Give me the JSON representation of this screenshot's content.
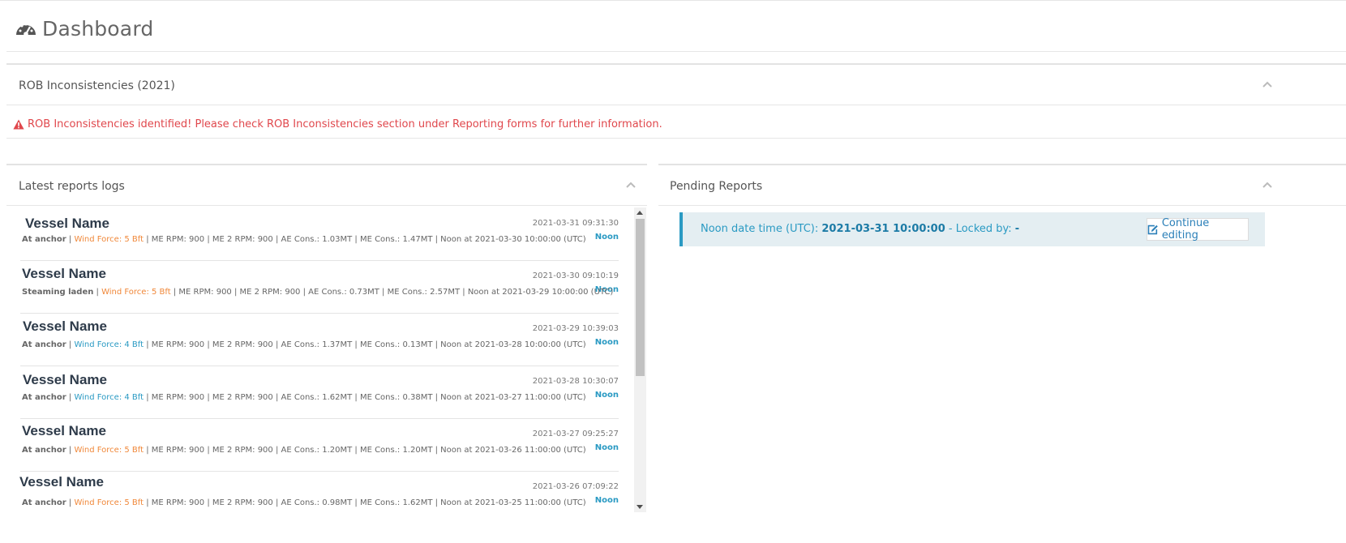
{
  "header": {
    "title": "Dashboard",
    "icon": "tachometer-icon"
  },
  "rob_panel": {
    "title": "ROB Inconsistencies (2021)",
    "alert": "ROB Inconsistencies identified! Please check ROB Inconsistencies section under Reporting forms for further information.",
    "alert_color": "#e0474c"
  },
  "latest_logs": {
    "title": "Latest reports logs",
    "items": [
      {
        "vessel": "Vessel Name",
        "timestamp": "2021-03-31 09:31:30",
        "type": "Noon",
        "status": "At anchor",
        "wind": "Wind Force: 5 Bft",
        "wind_color": "orange",
        "rest": "ME RPM: 900 | ME 2 RPM: 900 | AE Cons.: 1.03MT | ME Cons.: 1.47MT | Noon at 2021-03-30 10:00:00 (UTC)"
      },
      {
        "vessel": "Vessel Name",
        "timestamp": "2021-03-30 09:10:19",
        "type": "Noon",
        "status": "Steaming laden",
        "wind": "Wind Force: 5 Bft",
        "wind_color": "orange",
        "rest": "ME RPM: 900 | ME 2 RPM: 900 | AE Cons.: 0.73MT | ME Cons.: 2.57MT | Noon at 2021-03-29 10:00:00 (UTC)"
      },
      {
        "vessel": "Vessel Name",
        "timestamp": "2021-03-29 10:39:03",
        "type": "Noon",
        "status": "At anchor",
        "wind": "Wind Force: 4 Bft",
        "wind_color": "blue",
        "rest": "ME RPM: 900 | ME 2 RPM: 900 | AE Cons.: 1.37MT | ME Cons.: 0.13MT | Noon at 2021-03-28 10:00:00 (UTC)"
      },
      {
        "vessel": "Vessel Name",
        "timestamp": "2021-03-28 10:30:07",
        "type": "Noon",
        "status": "At anchor",
        "wind": "Wind Force: 4 Bft",
        "wind_color": "blue",
        "rest": "ME RPM: 900 | ME 2 RPM: 900 | AE Cons.: 1.62MT | ME Cons.: 0.38MT | Noon at 2021-03-27 11:00:00 (UTC)"
      },
      {
        "vessel": "Vessel Name",
        "timestamp": "2021-03-27 09:25:27",
        "type": "Noon",
        "status": "At anchor",
        "wind": "Wind Force: 5 Bft",
        "wind_color": "orange",
        "rest": "ME RPM: 900 | ME 2 RPM: 900 | AE Cons.: 1.20MT | ME Cons.: 1.20MT | Noon at 2021-03-26 11:00:00 (UTC)"
      },
      {
        "vessel": "Vessel Name",
        "timestamp": "2021-03-26 07:09:22",
        "type": "Noon",
        "status": "At anchor",
        "wind": "Wind Force: 5 Bft",
        "wind_color": "orange",
        "rest": "ME RPM: 900 | ME 2 RPM: 900 | AE Cons.: 0.98MT | ME Cons.: 1.62MT | Noon at 2021-03-25 11:00:00 (UTC)"
      }
    ]
  },
  "pending_reports": {
    "title": "Pending Reports",
    "label": "Noon date time (UTC): ",
    "datetime": "2021-03-31 10:00:00",
    "locked_label": " - Locked by: ",
    "locked_by": "-",
    "button": "Continue editing"
  },
  "colors": {
    "accent": "#2a9ac3",
    "alert": "#e0474c",
    "wind_orange": "#f0883a"
  }
}
